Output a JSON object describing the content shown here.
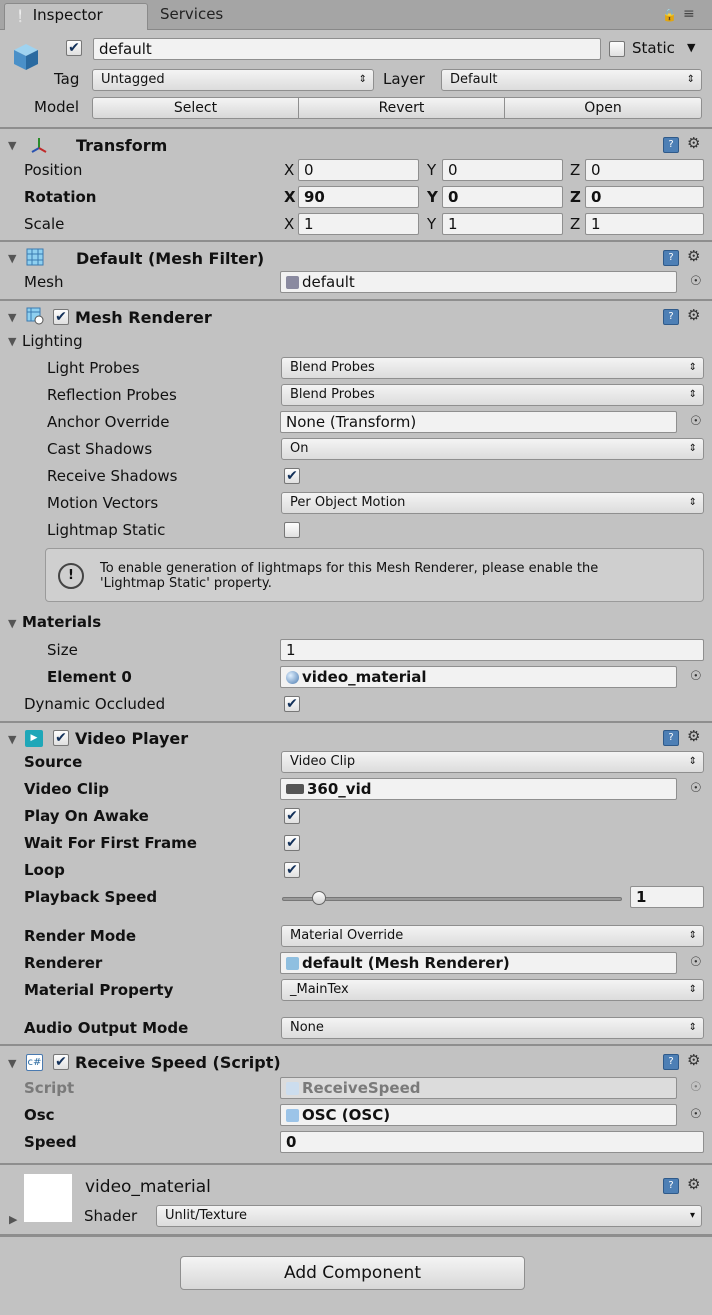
{
  "tabs": {
    "inspector": "Inspector",
    "services": "Services"
  },
  "object": {
    "active_checked": true,
    "name": "default",
    "static_label": "Static",
    "static_checked": false
  },
  "tag_row": {
    "tag_label": "Tag",
    "tag_value": "Untagged",
    "layer_label": "Layer",
    "layer_value": "Default"
  },
  "model_row": {
    "label": "Model",
    "select": "Select",
    "revert": "Revert",
    "open": "Open"
  },
  "transform": {
    "title": "Transform",
    "position": {
      "label": "Position",
      "x": "0",
      "y": "0",
      "z": "0"
    },
    "rotation": {
      "label": "Rotation",
      "x": "90",
      "y": "0",
      "z": "0"
    },
    "scale": {
      "label": "Scale",
      "x": "1",
      "y": "1",
      "z": "1"
    },
    "axis": {
      "x": "X",
      "y": "Y",
      "z": "Z"
    }
  },
  "mesh_filter": {
    "title": "Default (Mesh Filter)",
    "mesh_label": "Mesh",
    "mesh_value": "default"
  },
  "mesh_renderer": {
    "title": "Mesh Renderer",
    "lighting_label": "Lighting",
    "light_probes": {
      "label": "Light Probes",
      "value": "Blend Probes"
    },
    "reflection_probes": {
      "label": "Reflection Probes",
      "value": "Blend Probes"
    },
    "anchor_override": {
      "label": "Anchor Override",
      "value": "None (Transform)"
    },
    "cast_shadows": {
      "label": "Cast Shadows",
      "value": "On"
    },
    "receive_shadows": {
      "label": "Receive Shadows",
      "checked": true
    },
    "motion_vectors": {
      "label": "Motion Vectors",
      "value": "Per Object Motion"
    },
    "lightmap_static": {
      "label": "Lightmap Static",
      "checked": false
    },
    "help_line1": "To enable generation of lightmaps for this Mesh Renderer, please enable the",
    "help_line2": "'Lightmap Static' property.",
    "materials_label": "Materials",
    "size": {
      "label": "Size",
      "value": "1"
    },
    "element0": {
      "label": "Element 0",
      "value": "video_material"
    },
    "dynamic_occluded": {
      "label": "Dynamic Occluded",
      "checked": true
    }
  },
  "video_player": {
    "title": "Video Player",
    "source": {
      "label": "Source",
      "value": "Video Clip"
    },
    "video_clip": {
      "label": "Video Clip",
      "value": "360_vid"
    },
    "play_on_awake": {
      "label": "Play On Awake",
      "checked": true
    },
    "wait_first_frame": {
      "label": "Wait For First Frame",
      "checked": true
    },
    "loop": {
      "label": "Loop",
      "checked": true
    },
    "playback_speed": {
      "label": "Playback Speed",
      "value": "1",
      "slider_fraction": 0.11
    },
    "render_mode": {
      "label": "Render Mode",
      "value": "Material Override"
    },
    "renderer": {
      "label": "Renderer",
      "value": "default (Mesh Renderer)"
    },
    "material_property": {
      "label": "Material Property",
      "value": "_MainTex"
    },
    "audio_output": {
      "label": "Audio Output Mode",
      "value": "None"
    }
  },
  "receive_speed": {
    "title": "Receive Speed (Script)",
    "script": {
      "label": "Script",
      "value": "ReceiveSpeed"
    },
    "osc": {
      "label": "Osc",
      "value": "OSC (OSC)"
    },
    "speed": {
      "label": "Speed",
      "value": "0"
    }
  },
  "material": {
    "name": "video_material",
    "shader_label": "Shader",
    "shader_value": "Unlit/Texture"
  },
  "add_component": "Add Component",
  "colors": {
    "bg": "#c2c2c2",
    "field": "#f2f2f2",
    "accent": "#4d7fb5",
    "video_icon": "#1fa7b8"
  }
}
